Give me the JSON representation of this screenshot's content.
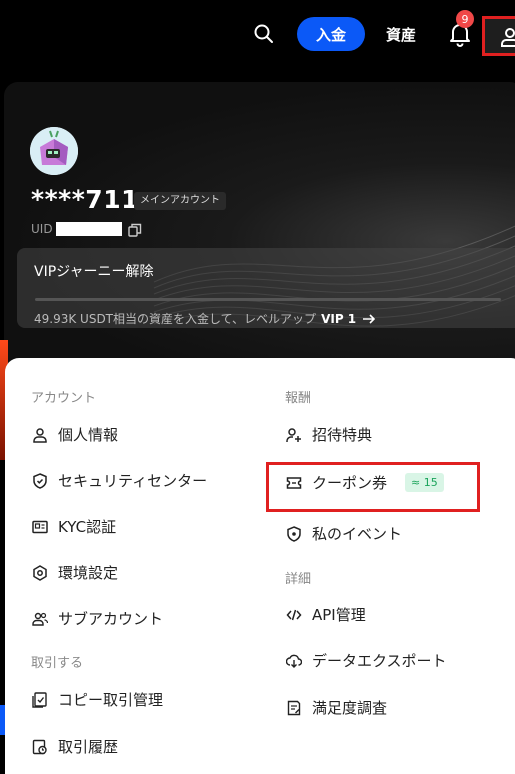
{
  "header": {
    "deposit_label": "入金",
    "assets_label": "資産",
    "notification_count": "9",
    "icons": [
      "search-icon",
      "bell-icon",
      "user-icon"
    ],
    "accent_color": "#0b59f7",
    "highlight_color": "#e02020"
  },
  "profile": {
    "username": "****711",
    "account_tag": "メインアカウント",
    "uid_label": "UID",
    "vip": {
      "title": "VIPジャーニー解除",
      "description": "49.93K USDT相当の資産を入金して、レベルアップ",
      "target_level": "VIP 1",
      "progress": 0.0
    }
  },
  "menu": {
    "account": {
      "title": "アカウント",
      "items": [
        "個人情報",
        "セキュリティセンター",
        "KYC認証",
        "環境設定",
        "サブアカウント"
      ]
    },
    "trade": {
      "title": "取引する",
      "items": [
        "コピー取引管理",
        "取引履歴"
      ]
    },
    "rewards": {
      "title": "報酬",
      "items": [
        "招待特典",
        "クーポン券",
        "私のイベント"
      ],
      "coupon_count": "≈ 15"
    },
    "details": {
      "title": "詳細",
      "items": [
        "API管理",
        "データエクスポート",
        "満足度調査"
      ]
    }
  }
}
